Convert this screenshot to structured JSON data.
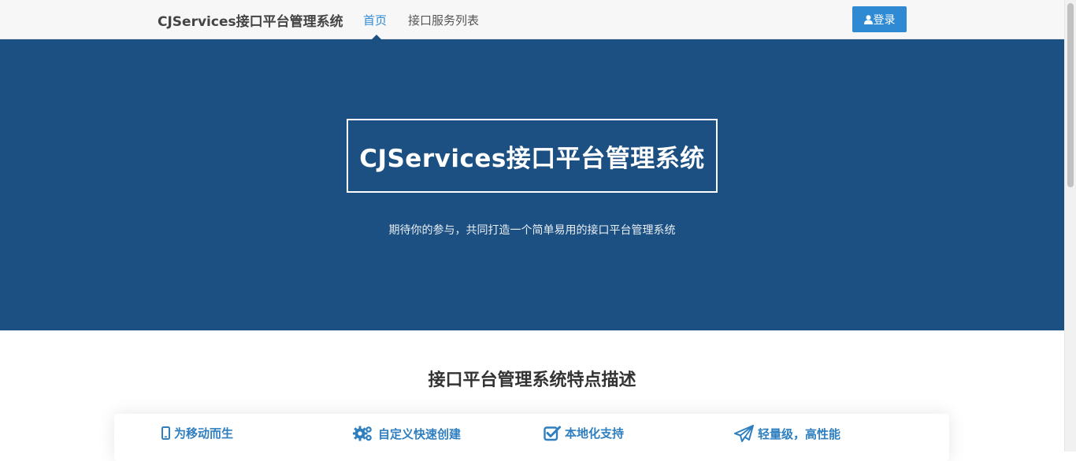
{
  "navbar": {
    "brand": "CJServices接口平台管理系统",
    "links": [
      {
        "label": "首页",
        "active": true
      },
      {
        "label": "接口服务列表",
        "active": false
      }
    ],
    "login_label": "登录",
    "user_icon": "user-icon"
  },
  "hero": {
    "title": "CJServices接口平台管理系统",
    "subtitle": "期待你的参与，共同打造一个简单易用的接口平台管理系统"
  },
  "features": {
    "heading": "接口平台管理系统特点描述",
    "items": [
      {
        "label": "为移动而生",
        "icon": "mobile-icon"
      },
      {
        "label": "自定义快速创建",
        "icon": "gears-icon"
      },
      {
        "label": "本地化支持",
        "icon": "check-square-icon"
      },
      {
        "label": "轻量级，高性能",
        "icon": "paper-plane-icon"
      }
    ]
  },
  "colors": {
    "primary": "#2f8ad3",
    "hero_bg": "#1d5082",
    "navbar_bg": "#f7f7f7",
    "feature_text": "#2f7fc0"
  }
}
